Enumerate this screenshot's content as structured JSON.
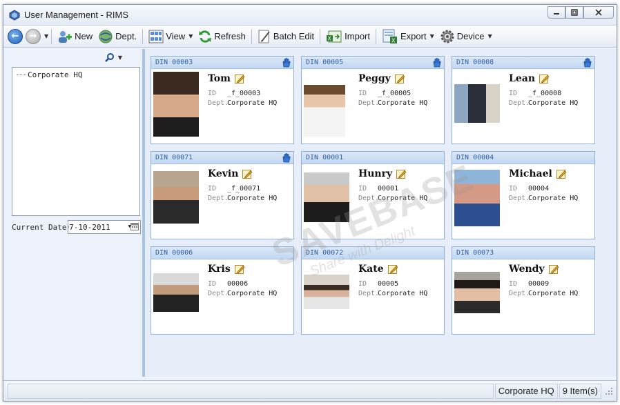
{
  "window": {
    "title": "User Management - RIMS"
  },
  "toolbar": {
    "new_label": "New",
    "dept_label": "Dept.",
    "view_label": "View",
    "refresh_label": "Refresh",
    "batch_edit_label": "Batch Edit",
    "import_label": "Import",
    "export_label": "Export",
    "device_label": "Device"
  },
  "tree": {
    "root": "Corporate HQ"
  },
  "date": {
    "label": "Current Date",
    "value": "07-10-2011"
  },
  "card_labels": {
    "id": "ID",
    "dept": "Dept."
  },
  "cards": [
    {
      "din": "DIN 00003",
      "name": "Tom",
      "id": "_f_00003",
      "dept": "Corporate HQ"
    },
    {
      "din": "DIN 00005",
      "name": "Peggy",
      "id": "_f_00005",
      "dept": "Corporate HQ"
    },
    {
      "din": "DIN 00008",
      "name": "Lean",
      "id": "_f_00008",
      "dept": "Corporate HQ"
    },
    {
      "din": "DIN 00071",
      "name": "Kevin",
      "id": "_f_00071",
      "dept": "Corporate HQ"
    },
    {
      "din": "DIN 00001",
      "name": "Hunry",
      "id": "00001",
      "dept": "Corporate HQ"
    },
    {
      "din": "DIN 00004",
      "name": "Michael",
      "id": "00004",
      "dept": "Corporate HQ"
    },
    {
      "din": "DIN 00006",
      "name": "Kris",
      "id": "00006",
      "dept": "Corporate HQ"
    },
    {
      "din": "DIN 00072",
      "name": "Kate",
      "id": "00005",
      "dept": "Corporate HQ"
    },
    {
      "din": "DIN 00073",
      "name": "Wendy",
      "id": "00009",
      "dept": "Corporate HQ"
    }
  ],
  "watermark": {
    "main": "SAVEBASE",
    "tagline": "Share with Delight"
  },
  "status": {
    "dept": "Corporate HQ",
    "count": "9 Item(s)"
  },
  "colors": {
    "accent": "#2e5f9e",
    "card_border": "#8fb0d8",
    "header_bg": "#c3d8f2"
  }
}
